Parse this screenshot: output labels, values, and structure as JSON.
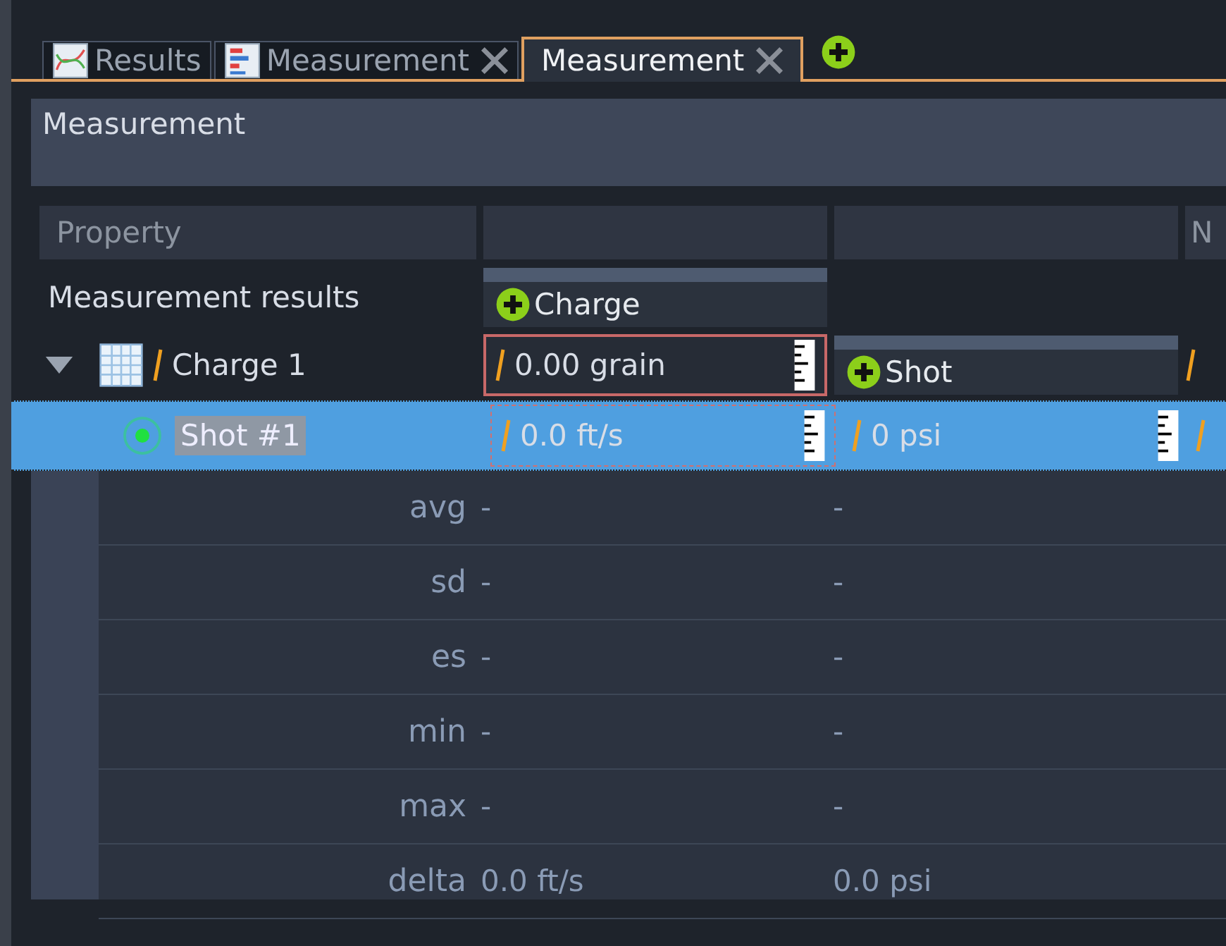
{
  "tabs": [
    {
      "label": "Results",
      "kind": "chart",
      "closable": false,
      "selected": false
    },
    {
      "label": "Measurement",
      "kind": "table",
      "closable": true,
      "selected": false
    },
    {
      "label": "Measurement",
      "kind": "plain",
      "closable": true,
      "selected": true
    }
  ],
  "panel_title": "Measurement",
  "header": {
    "property": "Property",
    "column_4": "N"
  },
  "results_row": {
    "label": "Measurement results",
    "add_button": "Charge"
  },
  "charge": {
    "name": "Charge 1",
    "expanded": true,
    "value": "0.00 grain",
    "add_button": "Shot"
  },
  "shot": {
    "name": "Shot #1",
    "selected": true,
    "values": [
      "0.0 ft/s",
      "0 psi"
    ]
  },
  "stats": [
    {
      "label": "avg",
      "values": [
        "-",
        "-"
      ]
    },
    {
      "label": "sd",
      "values": [
        "-",
        "-"
      ]
    },
    {
      "label": "es",
      "values": [
        "-",
        "-"
      ]
    },
    {
      "label": "min",
      "values": [
        "-",
        "-"
      ]
    },
    {
      "label": "max",
      "values": [
        "-",
        "-"
      ]
    },
    {
      "label": "delta",
      "values": [
        "0.0 ft/s",
        "0.0 psi"
      ]
    }
  ]
}
